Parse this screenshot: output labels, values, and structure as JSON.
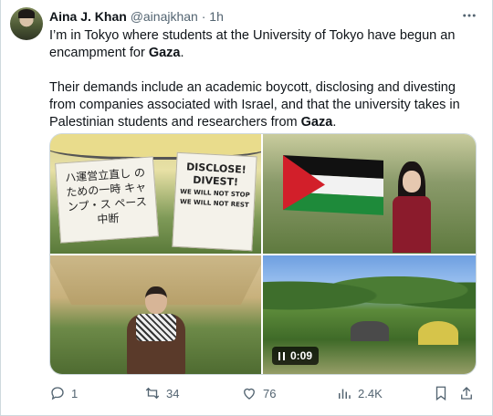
{
  "tweet": {
    "author_name": "Aina J. Khan",
    "handle": "@ainajkhan",
    "separator": "·",
    "time": "1h",
    "text_line1_pre": "I’m in Tokyo where students at the University of Tokyo have begun an encampment for ",
    "text_line1_bold": "Gaza",
    "text_line1_post": ".",
    "text_para2_pre": "Their demands include an academic boycott, disclosing and divesting from companies associated with Israel, and that the university takes in Palestinian students and researchers from ",
    "text_para2_bold": "Gaza",
    "text_para2_post": "."
  },
  "media": {
    "sign1_text": "ハ運営立直し のための一時 キャンプ・ス ペース中断",
    "sign2_line1": "DISCLOSE!",
    "sign2_line2": "DIVEST!",
    "sign2_line3": "WE WILL NOT STOP",
    "sign2_line4": "WE WILL NOT REST",
    "video_time": "0:09"
  },
  "actions": {
    "replies": "1",
    "reposts": "34",
    "likes": "76",
    "views": "2.4K"
  },
  "colors": {
    "text": "#0f1419",
    "muted": "#536471",
    "border": "#cfd9de"
  }
}
